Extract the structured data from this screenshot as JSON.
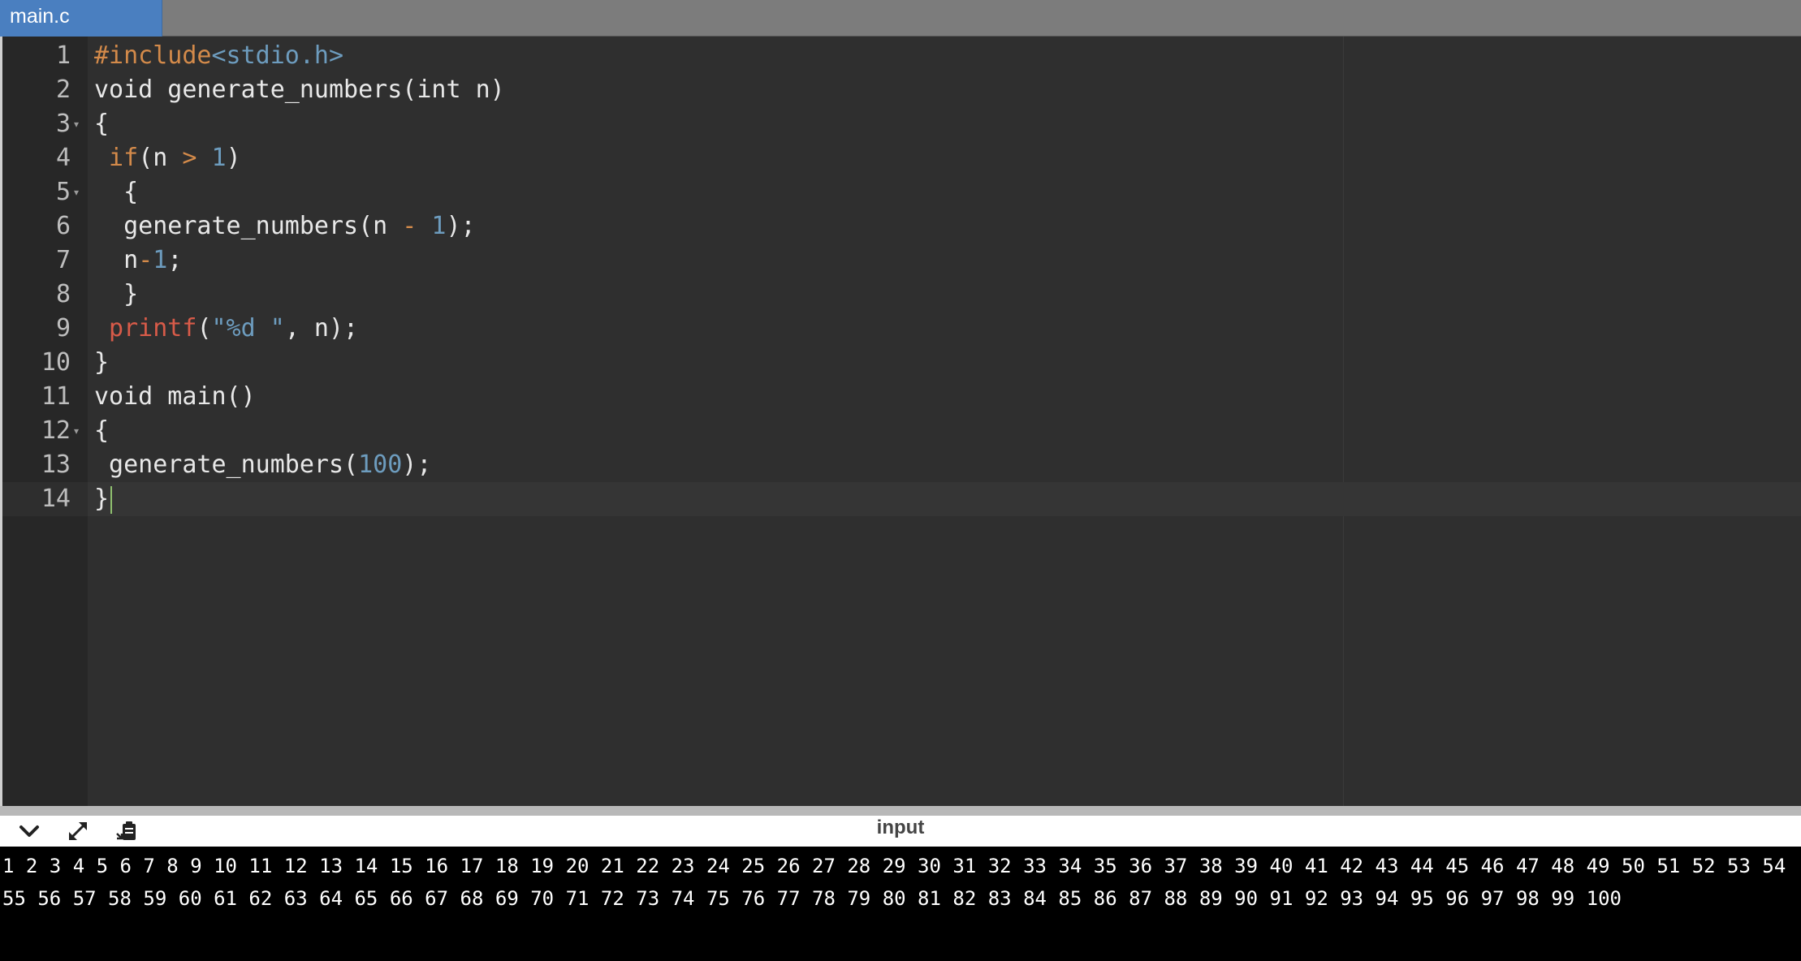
{
  "tab": {
    "label": "main.c"
  },
  "code": {
    "lines": [
      {
        "num": "1",
        "fold": "",
        "tokens": [
          [
            "tok-pre",
            "#include"
          ],
          [
            "tok-str",
            "<stdio.h>"
          ]
        ]
      },
      {
        "num": "2",
        "fold": "",
        "tokens": [
          [
            "",
            "void generate_numbers(int n)"
          ]
        ]
      },
      {
        "num": "3",
        "fold": "▾",
        "tokens": [
          [
            "",
            "{"
          ]
        ]
      },
      {
        "num": "4",
        "fold": "",
        "tokens": [
          [
            "",
            ""
          ],
          [
            "tok-kw",
            " if"
          ],
          [
            "",
            "(n "
          ],
          [
            "tok-op",
            ">"
          ],
          [
            "",
            ""
          ],
          [
            "tok-num",
            " 1"
          ],
          [
            "",
            ")"
          ]
        ]
      },
      {
        "num": "5",
        "fold": "▾",
        "tokens": [
          [
            "",
            "",
            " "
          ],
          [
            "",
            "  {"
          ]
        ]
      },
      {
        "num": "6",
        "fold": "",
        "tokens": [
          [
            "",
            "  generate_numbers(n "
          ],
          [
            "tok-op",
            "-"
          ],
          [
            "tok-num",
            " 1"
          ],
          [
            "",
            ");"
          ]
        ]
      },
      {
        "num": "7",
        "fold": "",
        "tokens": [
          [
            "",
            "  n"
          ],
          [
            "tok-op",
            "-"
          ],
          [
            "tok-num",
            "1"
          ],
          [
            "",
            ";"
          ]
        ]
      },
      {
        "num": "8",
        "fold": "",
        "tokens": [
          [
            "",
            "  }"
          ]
        ]
      },
      {
        "num": "9",
        "fold": "",
        "tokens": [
          [
            "tok-fn",
            " printf"
          ],
          [
            "",
            "("
          ],
          [
            "tok-str",
            "\"%d \""
          ],
          [
            "",
            ", n);"
          ]
        ]
      },
      {
        "num": "10",
        "fold": "",
        "tokens": [
          [
            "",
            "}"
          ]
        ]
      },
      {
        "num": "11",
        "fold": "",
        "tokens": [
          [
            "",
            "void main()"
          ]
        ]
      },
      {
        "num": "12",
        "fold": "▾",
        "tokens": [
          [
            "",
            "{"
          ]
        ]
      },
      {
        "num": "13",
        "fold": "",
        "tokens": [
          [
            "",
            " generate_numbers("
          ],
          [
            "tok-num",
            "100"
          ],
          [
            "",
            ");"
          ]
        ]
      },
      {
        "num": "14",
        "fold": "",
        "tokens": [
          [
            "",
            "}"
          ]
        ],
        "cursor": true
      }
    ],
    "active_line": 14
  },
  "panel": {
    "title": "input",
    "icons": [
      "chevron-down-icon",
      "expand-icon",
      "clipboard-icon"
    ],
    "output": "1 2 3 4 5 6 7 8 9 10 11 12 13 14 15 16 17 18 19 20 21 22 23 24 25 26 27 28 29 30 31 32 33 34 35 36 37 38 39 40 41 42 43 44 45 46 47 48 49 50 51 52 53 54 55 56 57 58 59 60 61 62 63 64 65 66 67 68 69 70 71 72 73 74 75 76 77 78 79 80 81 82 83 84 85 86 87 88 89 90 91 92 93 94 95 96 97 98 99 100"
  }
}
